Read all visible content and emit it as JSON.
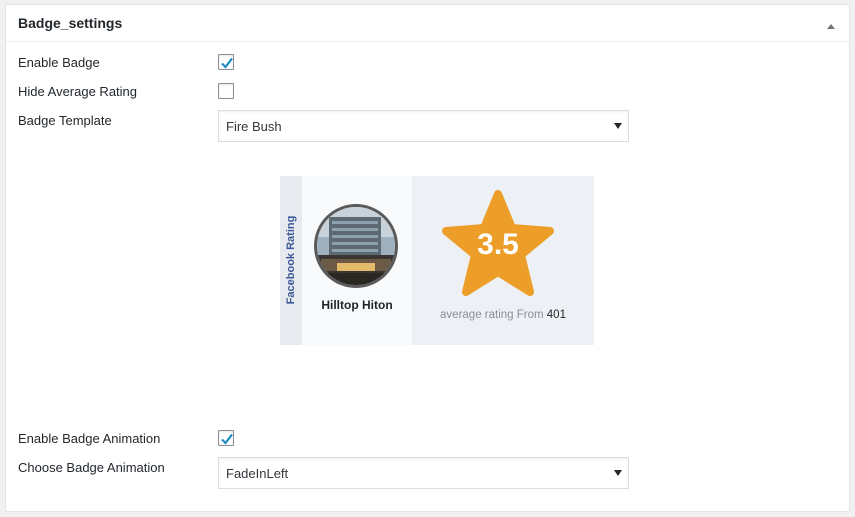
{
  "panel": {
    "title": "Badge_settings",
    "toggle_icon": "triangle-up-icon"
  },
  "fields": {
    "enable_badge": {
      "label": "Enable Badge",
      "checked": true
    },
    "hide_average_rating": {
      "label": "Hide Average Rating",
      "checked": false
    },
    "badge_template": {
      "label": "Badge Template",
      "value": "Fire Bush"
    },
    "enable_badge_animation": {
      "label": "Enable Badge Animation",
      "checked": true
    },
    "choose_badge_animation": {
      "label": "Choose Badge Animation",
      "value": "FadeInLeft"
    }
  },
  "badge": {
    "platform": "Facebook Rating",
    "business_name": "Hilltop Hiton",
    "rating": "3.5",
    "caption": "average rating From",
    "review_count": "401",
    "colors": {
      "star": "#ec9e28",
      "platform_text": "#3b5998"
    }
  },
  "colors": {
    "checkmark": "#1e8cbe",
    "panel_bg": "#ffffff",
    "page_bg": "#f1f1f1"
  }
}
